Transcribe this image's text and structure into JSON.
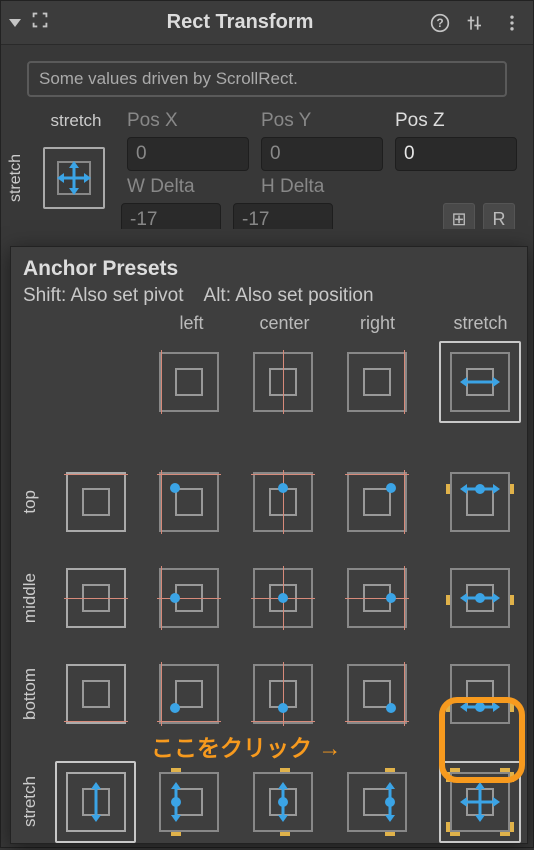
{
  "header": {
    "title": "Rect Transform"
  },
  "driven_msg": "Some values driven by ScrollRect.",
  "rt": {
    "top_stretch": "stretch",
    "left_stretch": "stretch",
    "posX_lbl": "Pos X",
    "posY_lbl": "Pos Y",
    "posZ_lbl": "Pos Z",
    "posX": "0",
    "posY": "0",
    "posZ": "0",
    "wdelta_lbl": "W Delta",
    "hdelta_lbl": "H Delta",
    "wdelta": "-17",
    "hdelta": "-17",
    "blueprint_btn": "⊞",
    "raw_btn": "R"
  },
  "popup": {
    "title": "Anchor Presets",
    "sub_shift": "Shift: Also set pivot",
    "sub_alt": "Alt: Also set position",
    "cols": {
      "left": "left",
      "center": "center",
      "right": "right",
      "stretch": "stretch"
    },
    "rows": {
      "top": "top",
      "middle": "middle",
      "bottom": "bottom",
      "stretch": "stretch"
    }
  },
  "annotation": {
    "text": "ここをクリック →"
  }
}
